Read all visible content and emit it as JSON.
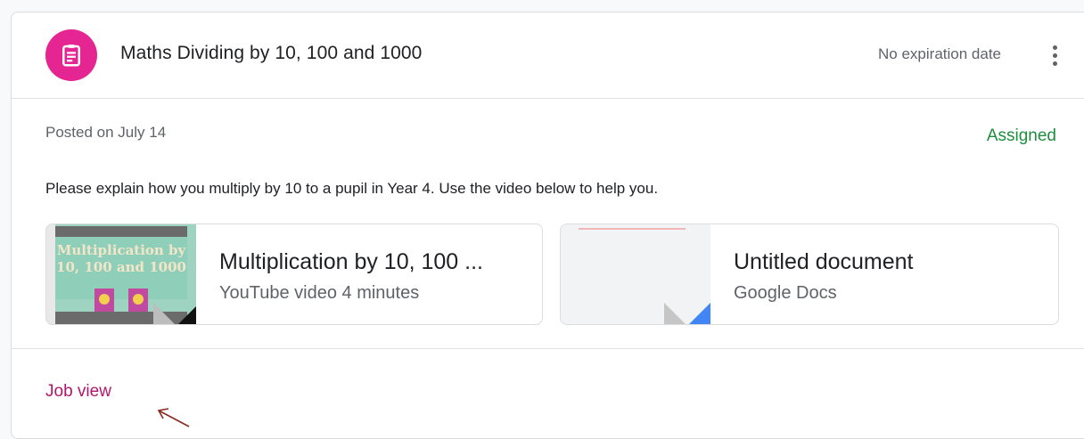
{
  "assignment": {
    "title": "Maths Dividing by 10, 100 and 1000",
    "due": "No expiration date",
    "posted": "Posted on July 14",
    "status": "Assigned",
    "status_color": "#1e8e3e",
    "instructions": "Please explain how you multiply by 10 to a pupil in Year 4. Use the video below to help you.",
    "icon": "assignment-icon",
    "accent": "#e52592"
  },
  "attachments": [
    {
      "title": "Multiplication by 10, 100 ...",
      "subtitle": "YouTube video 4 minutes",
      "thumbnail_text": "Multiplication by 10, 100 and 1000"
    },
    {
      "title": "Untitled document",
      "subtitle": "Google Docs"
    }
  ],
  "footer": {
    "link": "Job view",
    "link_color": "#b0166b"
  }
}
